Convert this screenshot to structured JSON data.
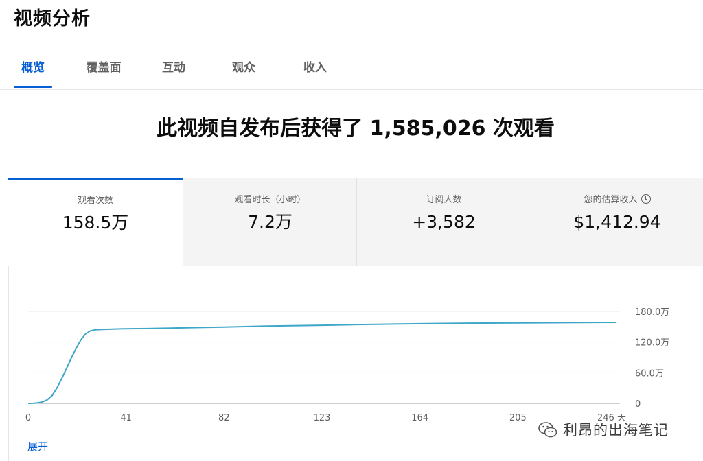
{
  "page": {
    "title": "视频分析"
  },
  "tabs": [
    {
      "label": "概览",
      "active": true
    },
    {
      "label": "覆盖面",
      "active": false
    },
    {
      "label": "互动",
      "active": false
    },
    {
      "label": "观众",
      "active": false
    },
    {
      "label": "收入",
      "active": false
    }
  ],
  "summary": {
    "headline": "此视频自发布后获得了 1,585,026 次观看"
  },
  "cards": [
    {
      "label": "观看次数",
      "value": "158.5万",
      "active": true
    },
    {
      "label": "观看时长（小时）",
      "value": "7.2万",
      "active": false
    },
    {
      "label": "订阅人数",
      "value": "+3,582",
      "active": false
    },
    {
      "label": "您的估算收入",
      "value": "$1,412.94",
      "active": false,
      "icon": "clock-icon"
    }
  ],
  "chart_data": {
    "type": "line",
    "x_unit": "天",
    "xlim": [
      0,
      246
    ],
    "ylim": [
      0,
      1800000
    ],
    "x_ticks": [
      "0",
      "41",
      "82",
      "123",
      "164",
      "205",
      "246 天"
    ],
    "x_tick_values": [
      0,
      41,
      82,
      123,
      164,
      205,
      246
    ],
    "y_ticks": [
      "0",
      "60.0万",
      "120.0万",
      "180.0万"
    ],
    "y_tick_values": [
      0,
      600000,
      1200000,
      1800000
    ],
    "grid": true,
    "line_color": "#3ea6c8",
    "series": [
      {
        "x": [
          0,
          2,
          4,
          6,
          8,
          10,
          12,
          14,
          16,
          18,
          20,
          22,
          24,
          26,
          28,
          30,
          32,
          35,
          40,
          50,
          60,
          70,
          82,
          100,
          123,
          140,
          164,
          185,
          205,
          225,
          246
        ],
        "values": [
          0,
          2000,
          10000,
          30000,
          70000,
          150000,
          300000,
          480000,
          680000,
          880000,
          1070000,
          1240000,
          1360000,
          1420000,
          1440000,
          1445000,
          1450000,
          1455000,
          1460000,
          1465000,
          1475000,
          1485000,
          1495000,
          1515000,
          1530000,
          1545000,
          1560000,
          1570000,
          1575000,
          1580000,
          1585000
        ]
      }
    ]
  },
  "actions": {
    "expand_label": "展开"
  },
  "watermark": {
    "text": "利昂的出海笔记",
    "icon": "wechat-icon"
  }
}
